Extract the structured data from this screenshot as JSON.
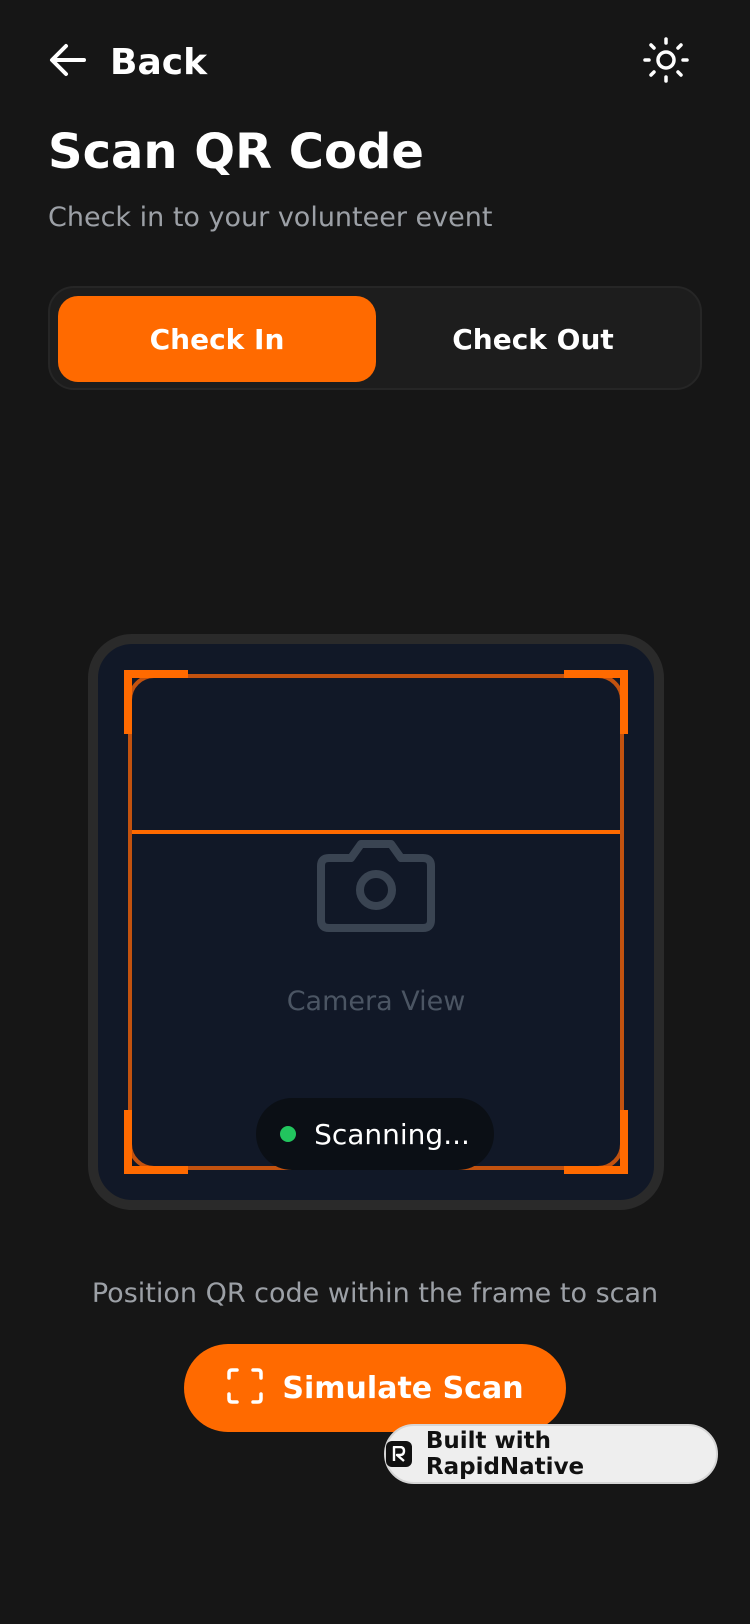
{
  "header": {
    "back_label": "Back",
    "back_icon": "arrow-left-icon",
    "theme_icon": "sun-icon"
  },
  "page": {
    "title": "Scan QR Code",
    "subtitle": "Check in to your volunteer event"
  },
  "mode_toggle": {
    "tabs": [
      {
        "label": "Check In",
        "active": true
      },
      {
        "label": "Check Out",
        "active": false
      }
    ]
  },
  "scanner": {
    "camera_icon": "camera-icon",
    "camera_label": "Camera View",
    "status_text": "Scanning..."
  },
  "instruction": "Position QR code within the frame to scan",
  "simulate_button": {
    "label": "Simulate Scan",
    "icon": "scan-frame-icon"
  },
  "badge": {
    "label": "Built with RapidNative"
  },
  "colors": {
    "background": "#161616",
    "accent": "#ff6a00",
    "camera_background": "#111827",
    "status_dot": "#22c55e",
    "muted_text": "#9ca0a6"
  }
}
